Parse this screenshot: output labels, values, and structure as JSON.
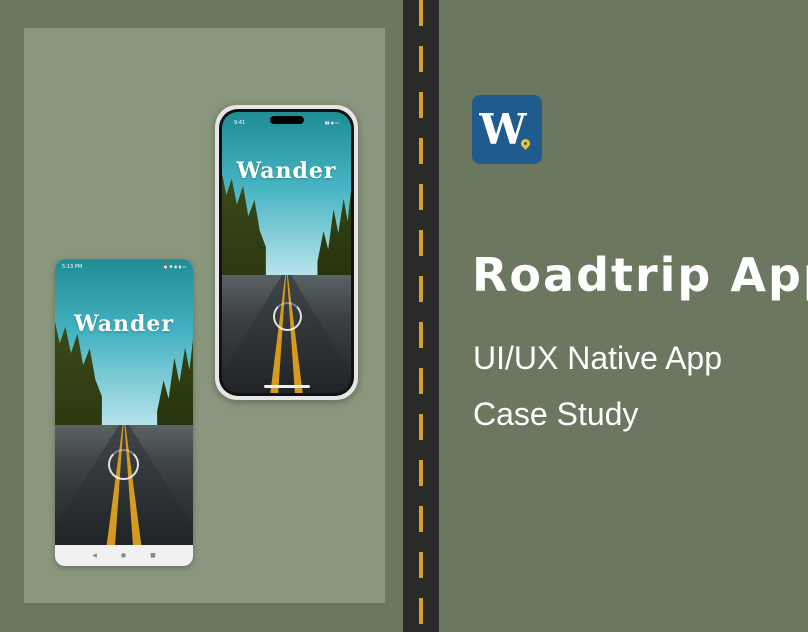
{
  "app": {
    "title": "Wander",
    "icon_letter": "W",
    "icon_name": "wander-logo-icon"
  },
  "hero": {
    "headline": "Roadtrip App",
    "line1": "UI/UX Native App",
    "line2": "Case Study"
  },
  "android": {
    "status_time": "5:13 PM",
    "status_icons": "⏰ ✱ ◉ ▮ ▭",
    "nav_back": "◀",
    "nav_home": "●",
    "nav_recent": "■"
  },
  "iphone": {
    "status_time": "9:41",
    "status_icons": "▮▮ ◉ ▭"
  },
  "colors": {
    "background": "#6b775e",
    "panel": "#8a967d",
    "road_strip": "#2a2a2a",
    "road_line": "#d4a12f",
    "icon_bg": "#1f5b8c",
    "pin": "#f1c232"
  }
}
